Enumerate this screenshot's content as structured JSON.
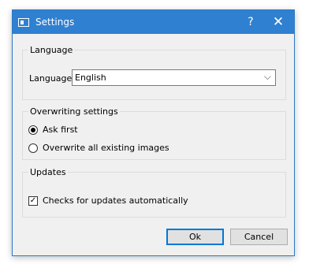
{
  "window": {
    "title": "Settings",
    "help_glyph": "?",
    "close_glyph": "✕"
  },
  "language_group": {
    "title": "Language",
    "label": "Language:",
    "selected": "English",
    "caret": "⌵"
  },
  "overwrite_group": {
    "title": "Overwriting settings",
    "options": [
      {
        "label": "Ask first",
        "checked": true
      },
      {
        "label": "Overwrite all existing images",
        "checked": false
      }
    ]
  },
  "updates_group": {
    "title": "Updates",
    "check_label": "Checks for updates automatically",
    "checked": true,
    "check_glyph": "✓"
  },
  "buttons": {
    "ok": "Ok",
    "cancel": "Cancel"
  },
  "colors": {
    "titlebar": "#2f80d0",
    "window_bg": "#f0f0f0",
    "accent": "#0078d7"
  }
}
